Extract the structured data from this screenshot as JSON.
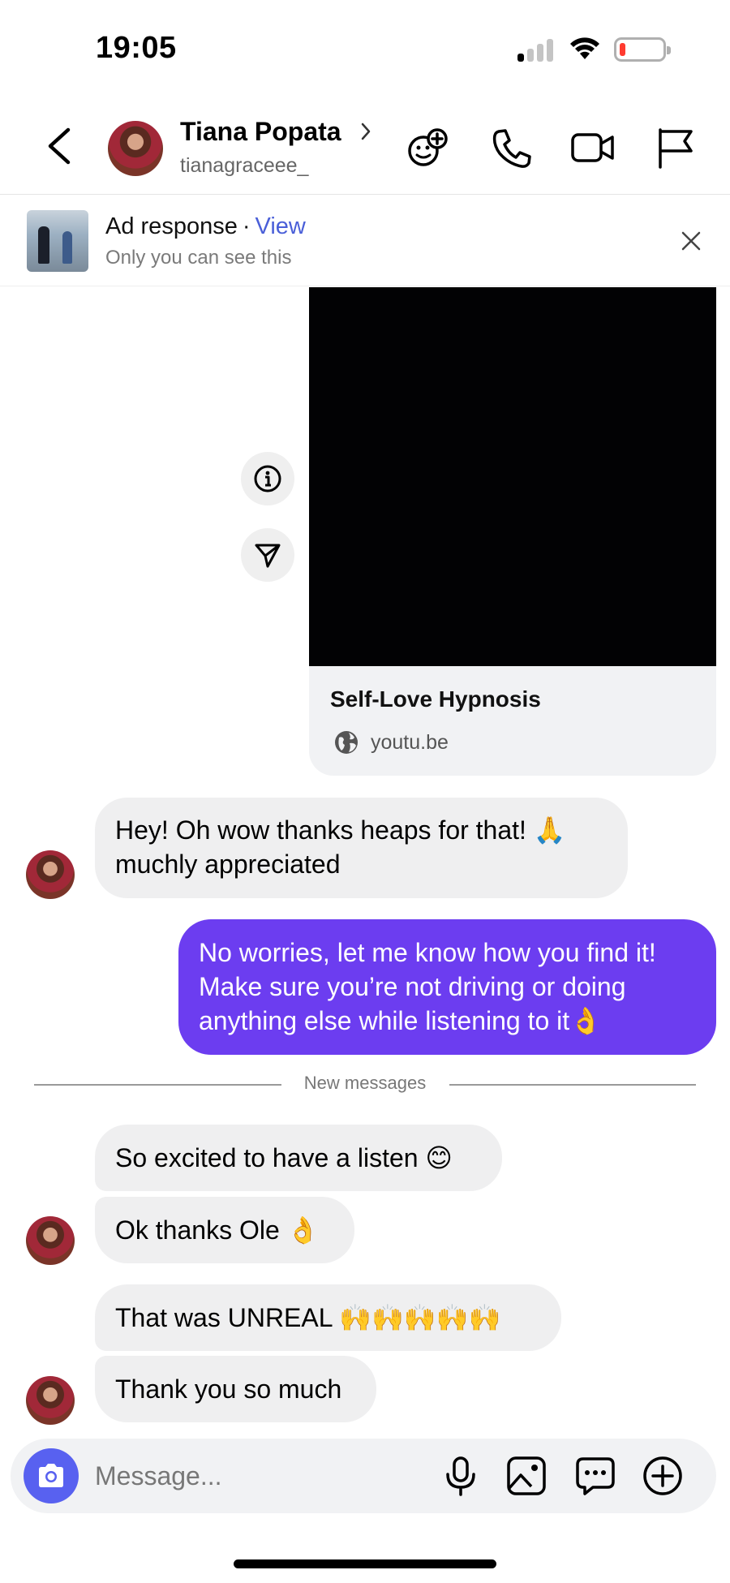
{
  "status_bar": {
    "time": "19:05"
  },
  "header": {
    "contact_name": "Tiana Popata",
    "contact_handle": "tianagraceee_"
  },
  "ad_banner": {
    "title": "Ad response",
    "separator": "·",
    "view_link": "View",
    "subtitle": "Only you can see this"
  },
  "link_card": {
    "title": "Self-Love Hypnosis",
    "domain": "youtu.be"
  },
  "messages": [
    {
      "direction": "incoming",
      "lines": [
        "Hey! Oh wow thanks heaps for that! 🙏",
        "muchly appreciated"
      ]
    },
    {
      "direction": "outgoing",
      "lines": [
        "No worries, let me know how you find it!",
        "Make sure you’re not driving or doing",
        "anything else while listening to it👌"
      ]
    },
    {
      "direction": "incoming",
      "text": "So excited to have a listen 😊"
    },
    {
      "direction": "incoming",
      "text": "Ok thanks Ole 👌"
    },
    {
      "direction": "incoming",
      "text": "That was UNREAL 🙌🙌🙌🙌🙌"
    },
    {
      "direction": "incoming",
      "text": "Thank you so much"
    }
  ],
  "divider": {
    "label": "New messages"
  },
  "composer": {
    "placeholder": "Message..."
  },
  "colors": {
    "outgoing_bubble": "#6c3df0",
    "incoming_bubble": "#efeff0",
    "link_blue": "#4a5fd8",
    "camera_button": "#5861f0"
  },
  "icons": {
    "header": [
      "back-chevron-icon",
      "add-effect-icon",
      "phone-icon",
      "video-camera-icon",
      "flag-icon"
    ],
    "composer": [
      "camera-icon",
      "microphone-icon",
      "image-icon",
      "sticker-chat-icon",
      "add-circle-icon"
    ]
  }
}
